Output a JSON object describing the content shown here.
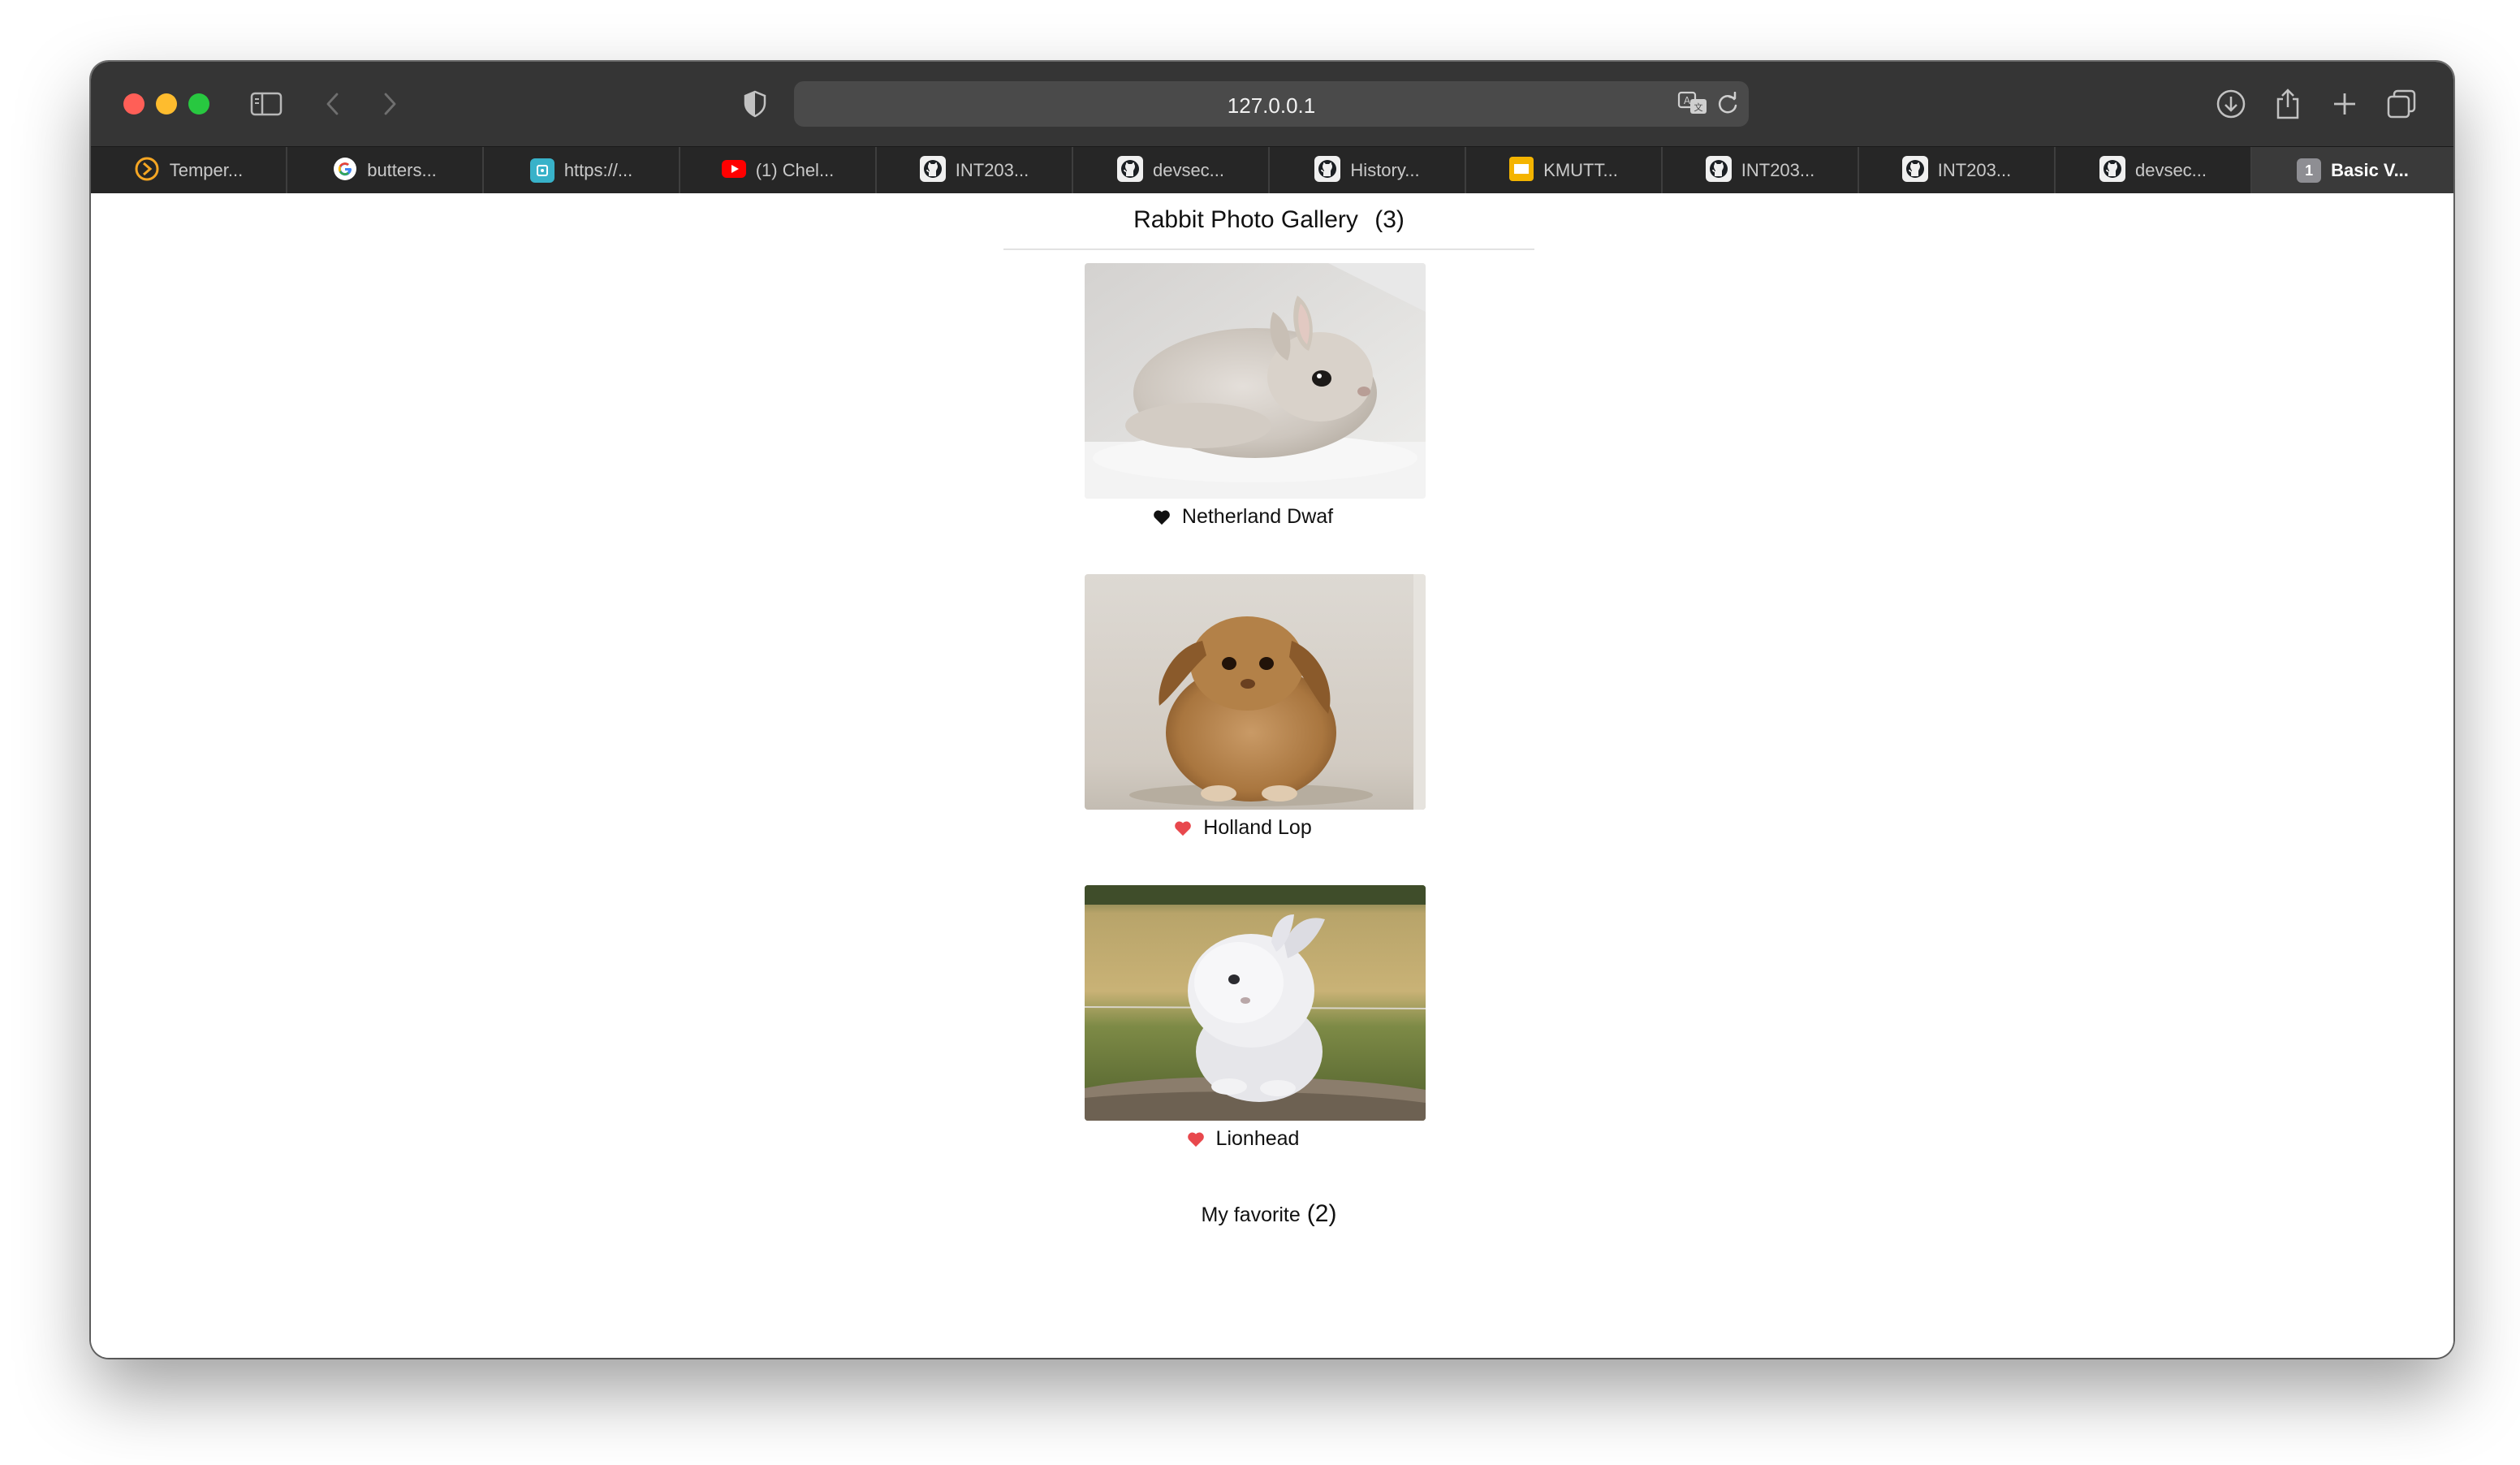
{
  "browser": {
    "url": "127.0.0.1",
    "tabs": [
      {
        "label": "Temper...",
        "icon": "tampermonkey-icon"
      },
      {
        "label": "butters...",
        "icon": "google-icon"
      },
      {
        "label": "https://...",
        "icon": "site-icon"
      },
      {
        "label": "(1) Chel...",
        "icon": "youtube-icon"
      },
      {
        "label": "INT203...",
        "icon": "github-icon"
      },
      {
        "label": "devsec...",
        "icon": "github-icon"
      },
      {
        "label": "History...",
        "icon": "github-icon"
      },
      {
        "label": "KMUTT...",
        "icon": "slides-icon"
      },
      {
        "label": "INT203...",
        "icon": "github-icon"
      },
      {
        "label": "INT203...",
        "icon": "github-icon"
      },
      {
        "label": "devsec...",
        "icon": "github-icon"
      },
      {
        "label": "Basic V...",
        "icon": "numbered-tab-icon",
        "badge": "1",
        "active": true
      }
    ]
  },
  "gallery": {
    "title": "Rabbit Photo Gallery",
    "count": "(3)",
    "items": [
      {
        "name": "Netherland Dwaf",
        "favorite": false,
        "heart_color": "#111111"
      },
      {
        "name": "Holland Lop",
        "favorite": true,
        "heart_color": "#e8484d"
      },
      {
        "name": "Lionhead",
        "favorite": true,
        "heart_color": "#e8484d"
      }
    ]
  },
  "favorites": {
    "label": "My favorite",
    "count": "(2)"
  }
}
